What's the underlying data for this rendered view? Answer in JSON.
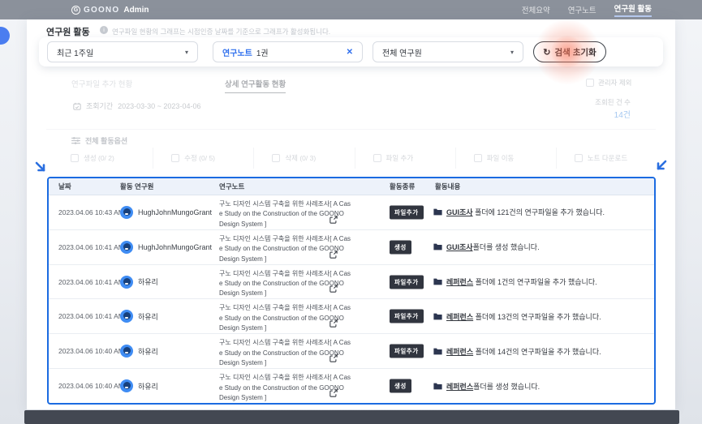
{
  "navbar": {
    "logo_g": "G",
    "logo_prefix": "GOONO",
    "logo_suffix": "Admin",
    "menu": [
      {
        "label": "전체요약",
        "active": false
      },
      {
        "label": "연구노트",
        "active": false
      },
      {
        "label": "연구원 활동",
        "active": true
      }
    ]
  },
  "page": {
    "title": "연구원 활동",
    "info_glyph": "i",
    "caption": "연구파일 현황의 그래프는 시점인증 날짜를 기준으로 그래프가 활성화됩니다."
  },
  "filters": {
    "period": "최근 1주일",
    "note_label": "연구노트",
    "note_value": "1권",
    "researcher": "전체 연구원",
    "reset_label": "검색 초기화"
  },
  "icons": {
    "caret": "▾",
    "close": "✕",
    "refresh": "↻"
  },
  "tabs": [
    {
      "label": "연구파일 추가 현황",
      "active": false
    },
    {
      "label": "상세 연구활동 현황",
      "active": true
    }
  ],
  "admin_exclude_label": "관리자 제외",
  "query": {
    "period_label": "조회기간",
    "period_value": "2023-03-30 ~ 2023-04-06",
    "count_label": "조회된 건 수",
    "count_value": "14건"
  },
  "activity_options": {
    "title": "전체 활동옵션",
    "options": [
      "생성 (0/ 2)",
      "수정 (0/ 5)",
      "삭제 (0/ 3)",
      "파일 추가",
      "파일 이동",
      "노트 다운로드"
    ]
  },
  "table": {
    "headers": [
      "날짜",
      "활동 연구원",
      "연구노트",
      "활동종류",
      "활동내용"
    ],
    "note_title_lines": [
      "구노 디자인 시스템 구축을 위한 사례조사[ A Cas",
      "e Study on the Construction of the GOONO",
      "Design System ]"
    ],
    "rows": [
      {
        "date": "2023.04.06 10:43 AM",
        "researcher": "HughJohnMungoGrant",
        "badge": "파일추가",
        "target": "GUI조사",
        "activity": " 폴더에 121건의 연구파일을 추가 했습니다."
      },
      {
        "date": "2023.04.06 10:41 AM",
        "researcher": "HughJohnMungoGrant",
        "badge": "생성",
        "target": "GUI조사",
        "activity": "폴더를 생성 했습니다."
      },
      {
        "date": "2023.04.06 10:41 AM",
        "researcher": "하유리",
        "badge": "파일추가",
        "target": "레퍼런스",
        "activity": " 폴더에 1건의 연구파일을 추가 했습니다."
      },
      {
        "date": "2023.04.06 10:41 AM",
        "researcher": "하유리",
        "badge": "파일추가",
        "target": "레퍼런스",
        "activity": " 폴더에 13건의 연구파일을 추가 했습니다."
      },
      {
        "date": "2023.04.06 10:40 AM",
        "researcher": "하유리",
        "badge": "파일추가",
        "target": "레퍼런스",
        "activity": " 폴더에 14건의 연구파일을 추가 했습니다."
      },
      {
        "date": "2023.04.06 10:40 AM",
        "researcher": "하유리",
        "badge": "생성",
        "target": "레퍼런스",
        "activity": "폴더를 생성 했습니다."
      }
    ]
  },
  "colors": {
    "primary_blue": "#2F6FED",
    "table_border": "#1B6BE1",
    "badge_bg": "#31353F",
    "glow": "#F97458",
    "navbar_bg": "#8B919B",
    "count_blue": "#4A90E2"
  }
}
